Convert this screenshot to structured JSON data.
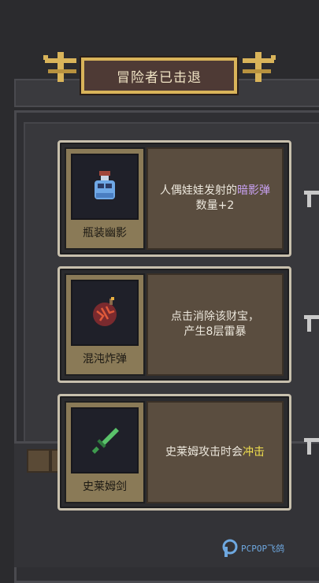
{
  "banner": {
    "title": "冒险者已击退"
  },
  "cards": [
    {
      "name": "瓶装幽影",
      "icon": "bottled-shadow-icon",
      "desc_pre": "人偶娃娃发射的",
      "desc_hl": "暗影弹",
      "desc_post": "数量+2",
      "hl_color": "#c7a0f0"
    },
    {
      "name": "混沌炸弹",
      "icon": "chaos-bomb-icon",
      "desc_pre": "点击消除该财宝，产生8层雷暴",
      "desc_hl": "",
      "desc_post": "",
      "hl_color": ""
    },
    {
      "name": "史莱姆剑",
      "icon": "slime-sword-icon",
      "desc_pre": "史莱姆攻击时会",
      "desc_hl": "冲击",
      "desc_post": "",
      "hl_color": "#f1e04e"
    }
  ],
  "watermark": {
    "text": "PCPOP飞鸽"
  },
  "colors": {
    "gold": "#d9b45a",
    "banner_bg": "#4e3a35",
    "card_border": "#c8c0ad"
  }
}
